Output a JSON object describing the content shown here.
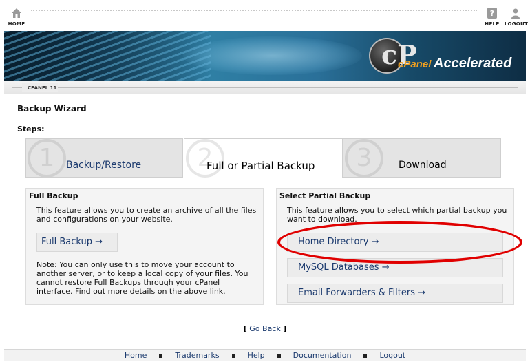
{
  "topbar": {
    "home_label": "HOME",
    "help_label": "HELP",
    "logout_label": "LOGOUT"
  },
  "banner": {
    "logo_letter": "cP",
    "brand_cpanel": "cPanel",
    "brand_accelerated": "Accelerated"
  },
  "version_label": "CPANEL 11",
  "page_title": "Backup Wizard",
  "steps_label": "Steps:",
  "steps": [
    {
      "number": "1",
      "label": "Backup/Restore"
    },
    {
      "number": "2",
      "label": "Full or Partial Backup"
    },
    {
      "number": "3",
      "label": "Download"
    }
  ],
  "full_backup": {
    "heading": "Full Backup",
    "description": "This feature allows you to create an archive of all the files and configurations on your website.",
    "button_label": "Full Backup →",
    "note": "Note: You can only use this to move your account to another server, or to keep a local copy of your files. You cannot restore Full Backups through your cPanel interface. Find out more details on the above link."
  },
  "partial_backup": {
    "heading": "Select Partial Backup",
    "description": "This feature allows you to select which partial backup you want to download.",
    "options": [
      {
        "label": "Home Directory →"
      },
      {
        "label": "MySQL Databases →"
      },
      {
        "label": "Email Forwarders & Filters →"
      }
    ]
  },
  "go_back": {
    "open_bracket": "[",
    "label": "Go Back",
    "close_bracket": "]"
  },
  "footer": {
    "links": [
      "Home",
      "Trademarks",
      "Help",
      "Documentation",
      "Logout"
    ]
  },
  "colors": {
    "link": "#1b3a6e",
    "highlight": "#e00000",
    "panel_bg": "#f4f4f4",
    "tab_bg": "#e4e4e4"
  }
}
